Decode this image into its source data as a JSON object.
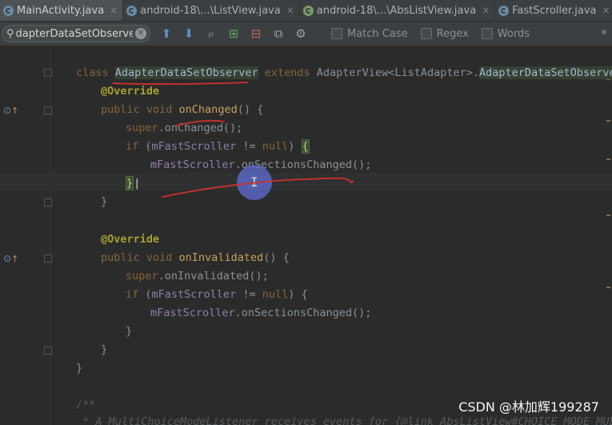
{
  "tabs": [
    {
      "label": "MainActivity.java",
      "icon": "class-icon",
      "active": true
    },
    {
      "label": "android-18\\...\\ListView.java",
      "icon": "class-icon"
    },
    {
      "label": "android-18\\...\\AbsListView.java",
      "icon": "library-class-icon"
    },
    {
      "label": "FastScroller.java",
      "icon": "class-icon"
    }
  ],
  "tab_more": "...",
  "tab_close_glyph": "×",
  "find": {
    "query": "dapterDataSetObserver",
    "options": [
      "Match Case",
      "Regex",
      "Words"
    ],
    "overflow": "»"
  },
  "code": {
    "l1_kw1": "class",
    "l1_cls": "AdapterDataSetObserver",
    "l1_kw2": "extends",
    "l1_rest": "AdapterView<ListAdapter>.",
    "l1_cls2": "AdapterDataSetObserver",
    "l1_end": " {",
    "l2": "@Override",
    "l3_kw": "public void",
    "l3_fn": "onChanged",
    "l3_end": "() {",
    "l4_kw": "super",
    "l4_rest": ".onChanged();",
    "l5_kw": "if",
    "l5_a": " (",
    "l5_field": "mFastScroller",
    "l5_b": " != ",
    "l5_null": "null",
    "l5_c": ") ",
    "l5_brace": "{",
    "l6_field": "mFastScroller",
    "l6_rest": ".onSectionsChanged();",
    "l7": "}",
    "l8": "}",
    "l9": "@Override",
    "l10_kw": "public void",
    "l10_fn": "onInvalidated",
    "l10_end": "() {",
    "l11_kw": "super",
    "l11_rest": ".onInvalidated();",
    "l12_kw": "if",
    "l12_a": " (",
    "l12_field": "mFastScroller",
    "l12_b": " != ",
    "l12_null": "null",
    "l12_c": ") {",
    "l13_field": "mFastScroller",
    "l13_rest": ".onSectionsChanged();",
    "l14": "}",
    "l15": "}",
    "l16": "}",
    "l17": "/**",
    "l18": " * A MultiChoiceModeListener receives events for {@link AbsListView#CHOICE_MODE_MULTIP"
  },
  "watermark": "CSDN @林加辉199287",
  "colors": {
    "annotation_pen": "#d0312d",
    "cursor_highlight": "#5f6ed7"
  }
}
